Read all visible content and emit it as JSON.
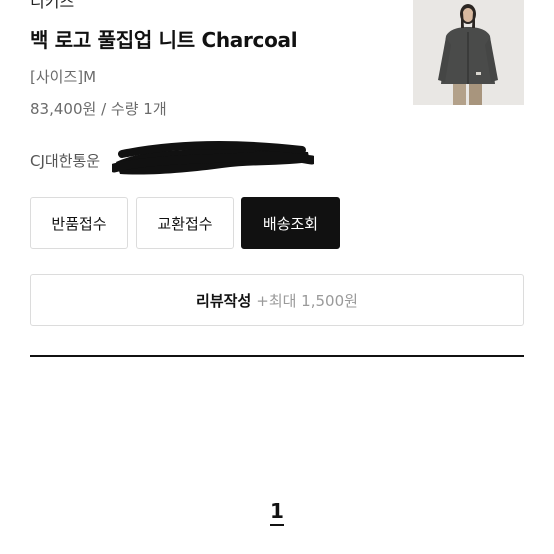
{
  "order_item": {
    "brand": "디키즈",
    "product_name": "백 로고 풀집업 니트 Charcoal",
    "option": "[사이즈]M",
    "price": "83,400원",
    "separator": "/",
    "quantity": "수량 1개",
    "courier": "CJ대한통운"
  },
  "actions": {
    "return_label": "반품접수",
    "exchange_label": "교환접수",
    "tracking_label": "배송조회",
    "review_label": "리뷰작성",
    "review_reward": "+최대 1,500원"
  },
  "pagination": {
    "current_page": "1"
  },
  "colors": {
    "primary_dark": "#111111",
    "muted_text": "#6b6b6b",
    "border": "#dcdcdc"
  }
}
